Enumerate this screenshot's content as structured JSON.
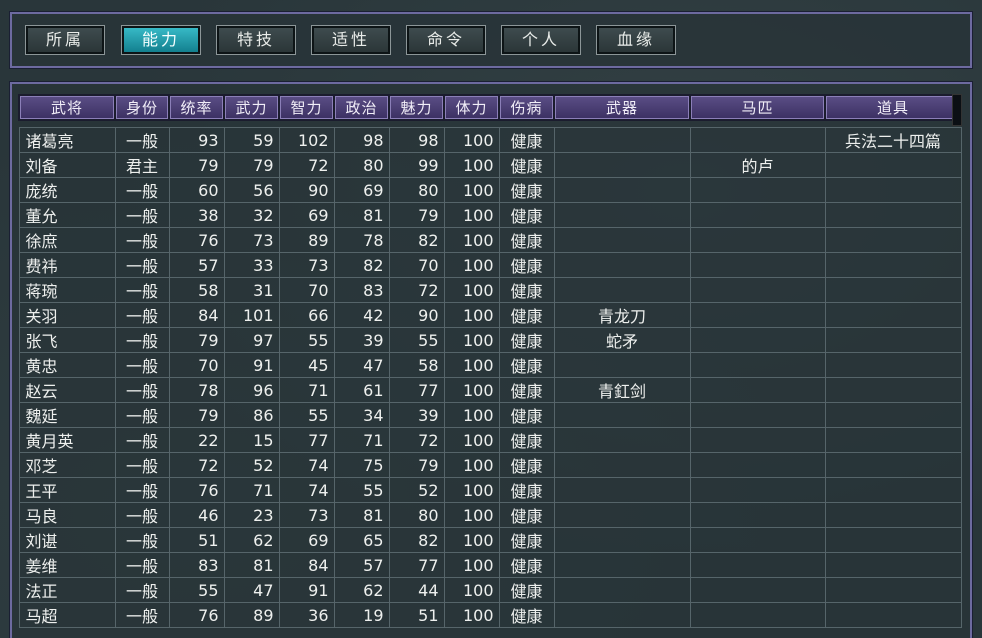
{
  "tabs": [
    {
      "label": "所属",
      "active": false
    },
    {
      "label": "能力",
      "active": true
    },
    {
      "label": "特技",
      "active": false
    },
    {
      "label": "适性",
      "active": false
    },
    {
      "label": "命令",
      "active": false
    },
    {
      "label": "个人",
      "active": false
    },
    {
      "label": "血缘",
      "active": false
    }
  ],
  "table": {
    "headers": [
      "武将",
      "身份",
      "统率",
      "武力",
      "智力",
      "政治",
      "魅力",
      "体力",
      "伤病",
      "武器",
      "马匹",
      "道具"
    ],
    "rows": [
      [
        "诸葛亮",
        "一般",
        "93",
        "59",
        "102",
        "98",
        "98",
        "100",
        "健康",
        "",
        "",
        "兵法二十四篇"
      ],
      [
        "刘备",
        "君主",
        "79",
        "79",
        "72",
        "80",
        "99",
        "100",
        "健康",
        "",
        "的卢",
        ""
      ],
      [
        "庞统",
        "一般",
        "60",
        "56",
        "90",
        "69",
        "80",
        "100",
        "健康",
        "",
        "",
        ""
      ],
      [
        "董允",
        "一般",
        "38",
        "32",
        "69",
        "81",
        "79",
        "100",
        "健康",
        "",
        "",
        ""
      ],
      [
        "徐庶",
        "一般",
        "76",
        "73",
        "89",
        "78",
        "82",
        "100",
        "健康",
        "",
        "",
        ""
      ],
      [
        "费祎",
        "一般",
        "57",
        "33",
        "73",
        "82",
        "70",
        "100",
        "健康",
        "",
        "",
        ""
      ],
      [
        "蒋琬",
        "一般",
        "58",
        "31",
        "70",
        "83",
        "72",
        "100",
        "健康",
        "",
        "",
        ""
      ],
      [
        "关羽",
        "一般",
        "84",
        "101",
        "66",
        "42",
        "90",
        "100",
        "健康",
        "青龙刀",
        "",
        ""
      ],
      [
        "张飞",
        "一般",
        "79",
        "97",
        "55",
        "39",
        "55",
        "100",
        "健康",
        "蛇矛",
        "",
        ""
      ],
      [
        "黄忠",
        "一般",
        "70",
        "91",
        "45",
        "47",
        "58",
        "100",
        "健康",
        "",
        "",
        ""
      ],
      [
        "赵云",
        "一般",
        "78",
        "96",
        "71",
        "61",
        "77",
        "100",
        "健康",
        "青釭剑",
        "",
        ""
      ],
      [
        "魏延",
        "一般",
        "79",
        "86",
        "55",
        "34",
        "39",
        "100",
        "健康",
        "",
        "",
        ""
      ],
      [
        "黄月英",
        "一般",
        "22",
        "15",
        "77",
        "71",
        "72",
        "100",
        "健康",
        "",
        "",
        ""
      ],
      [
        "邓芝",
        "一般",
        "72",
        "52",
        "74",
        "75",
        "79",
        "100",
        "健康",
        "",
        "",
        ""
      ],
      [
        "王平",
        "一般",
        "76",
        "71",
        "74",
        "55",
        "52",
        "100",
        "健康",
        "",
        "",
        ""
      ],
      [
        "马良",
        "一般",
        "46",
        "23",
        "73",
        "81",
        "80",
        "100",
        "健康",
        "",
        "",
        ""
      ],
      [
        "刘谌",
        "一般",
        "51",
        "62",
        "69",
        "65",
        "82",
        "100",
        "健康",
        "",
        "",
        ""
      ],
      [
        "姜维",
        "一般",
        "83",
        "81",
        "84",
        "57",
        "77",
        "100",
        "健康",
        "",
        "",
        ""
      ],
      [
        "法正",
        "一般",
        "55",
        "47",
        "91",
        "62",
        "44",
        "100",
        "健康",
        "",
        "",
        ""
      ],
      [
        "马超",
        "一般",
        "76",
        "89",
        "36",
        "19",
        "51",
        "100",
        "健康",
        "",
        "",
        ""
      ]
    ]
  },
  "colors": {
    "active_tab": "#1fa3b2",
    "header_bg": "#4b3f74",
    "panel_border": "#6d6aa0"
  }
}
